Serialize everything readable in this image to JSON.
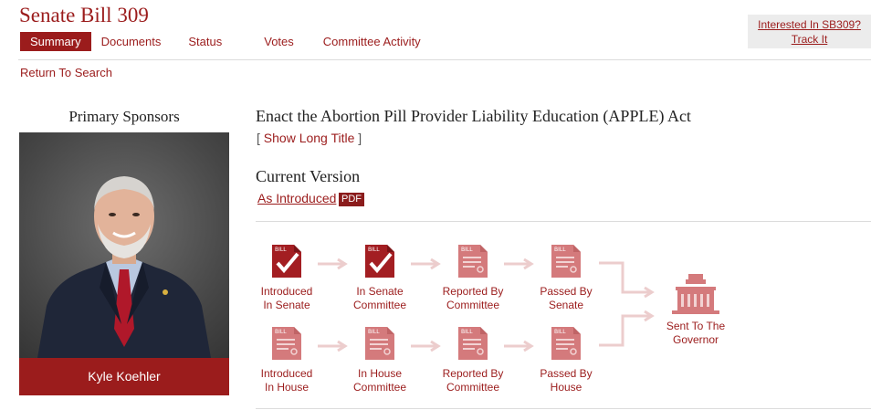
{
  "header": {
    "title": "Senate Bill 309",
    "tabs": [
      {
        "label": "Summary",
        "active": true
      },
      {
        "label": "Documents"
      },
      {
        "label": "Status"
      },
      {
        "label": "Votes"
      },
      {
        "label": "Committee Activity"
      }
    ],
    "return_link": "Return To Search"
  },
  "track": {
    "line1": "Interested In SB309?",
    "line2": "Track It"
  },
  "sponsors": {
    "heading": "Primary Sponsors",
    "name": "Kyle Koehler"
  },
  "bill": {
    "title": "Enact the Abortion Pill Provider Liability Education (APPLE) Act",
    "bracket_open": "[",
    "show_long_title": "Show Long Title",
    "bracket_close": "]",
    "current_version_heading": "Current Version",
    "version_link": "As Introduced",
    "pdf_label": "PDF"
  },
  "progress": {
    "senate": [
      {
        "line1": "Introduced",
        "line2": "In Senate",
        "done": true
      },
      {
        "line1": "In Senate",
        "line2": "Committee",
        "done": true
      },
      {
        "line1": "Reported By",
        "line2": "Committee",
        "done": false
      },
      {
        "line1": "Passed By",
        "line2": "Senate",
        "done": false
      }
    ],
    "house": [
      {
        "line1": "Introduced",
        "line2": "In House",
        "done": false
      },
      {
        "line1": "In House",
        "line2": "Committee",
        "done": false
      },
      {
        "line1": "Reported By",
        "line2": "Committee",
        "done": false
      },
      {
        "line1": "Passed By",
        "line2": "House",
        "done": false
      }
    ],
    "governor": {
      "line1": "Sent To The",
      "line2": "Governor"
    },
    "icon_label": "BILL",
    "colors": {
      "done": "#a31e22",
      "pending": "#d47a7c",
      "arrow": "#eccdcd"
    }
  }
}
